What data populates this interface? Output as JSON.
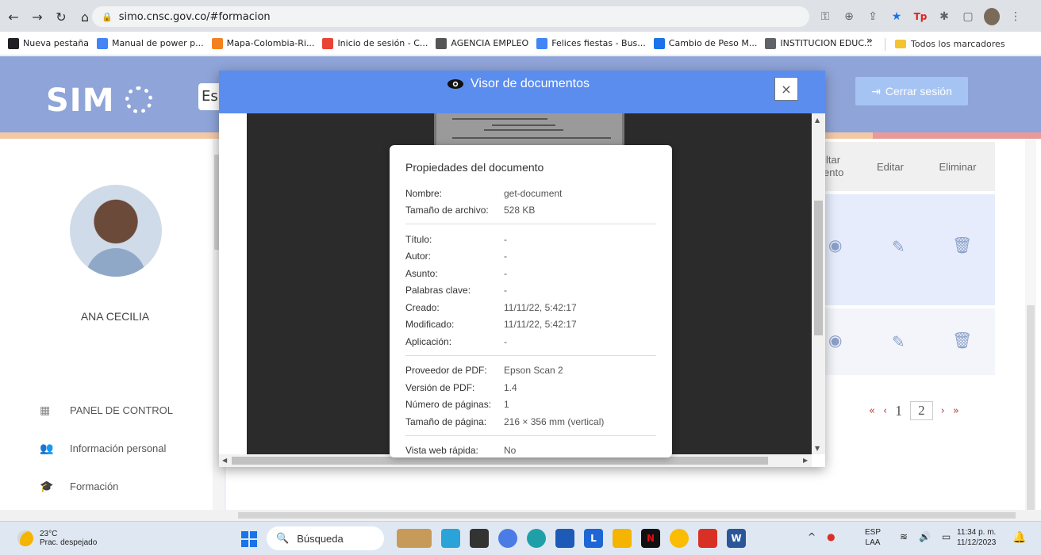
{
  "browser": {
    "url": "simo.cnsc.gov.co/#formacion",
    "bookmarks": [
      {
        "label": "Nueva pestaña",
        "icon": "globe-icon",
        "color": "#202124"
      },
      {
        "label": "Manual de power p...",
        "icon": "doc-icon",
        "color": "#4285f4"
      },
      {
        "label": "Mapa-Colombia-Ri...",
        "icon": "blogger-icon",
        "color": "#f4811f"
      },
      {
        "label": "Inicio de sesión - C...",
        "icon": "gmail-icon",
        "color": "#ea4335"
      },
      {
        "label": "AGENCIA EMPLEO",
        "icon": "agency-icon",
        "color": "#555555"
      },
      {
        "label": "Felices fiestas - Bus...",
        "icon": "google-icon",
        "color": "#4285f4"
      },
      {
        "label": "Cambio de Peso M...",
        "icon": "exchange-icon",
        "color": "#1a73e8"
      },
      {
        "label": "INSTITUCION EDUC...",
        "icon": "school-icon",
        "color": "#5f6368"
      }
    ],
    "bookmarks_more": "»",
    "all_bookmarks": "Todos los marcadores",
    "ext_tp": "Tp"
  },
  "site": {
    "logo_text": "SIM",
    "search_stub": "Es",
    "logout_label": "Cerrar sesión",
    "user_name": "ANA CECILIA",
    "sidebar": [
      {
        "label": "PANEL DE CONTROL",
        "icon": "dashboard-icon"
      },
      {
        "label": "Información personal",
        "icon": "people-icon"
      },
      {
        "label": "Formación",
        "icon": "education-icon"
      }
    ],
    "table": {
      "col_consult": "nsultar\numento",
      "col_edit": "Editar",
      "col_delete": "Eliminar"
    },
    "pager": {
      "first": "«",
      "prev": "‹",
      "page1": "1",
      "page2": "2",
      "next": "›",
      "last": "»"
    }
  },
  "modal": {
    "title": "Visor de documentos",
    "close": "×",
    "properties": {
      "heading": "Propiedades del documento",
      "group1": [
        {
          "k": "Nombre:",
          "v": "get-document"
        },
        {
          "k": "Tamaño de archivo:",
          "v": "528 KB"
        }
      ],
      "group2": [
        {
          "k": "Título:",
          "v": "-"
        },
        {
          "k": "Autor:",
          "v": "-"
        },
        {
          "k": "Asunto:",
          "v": "-"
        },
        {
          "k": "Palabras clave:",
          "v": "-"
        },
        {
          "k": "Creado:",
          "v": "11/11/22, 5:42:17"
        },
        {
          "k": "Modificado:",
          "v": "11/11/22, 5:42:17"
        },
        {
          "k": "Aplicación:",
          "v": "-"
        }
      ],
      "group3": [
        {
          "k": "Proveedor de PDF:",
          "v": "Epson Scan 2"
        },
        {
          "k": "Versión de PDF:",
          "v": "1.4"
        },
        {
          "k": "Número de páginas:",
          "v": "1"
        },
        {
          "k": "Tamaño de página:",
          "v": "216 × 356 mm (vertical)"
        }
      ],
      "group4": [
        {
          "k": "Vista web rápida:",
          "v": "No"
        }
      ]
    }
  },
  "taskbar": {
    "weather_temp": "23°C",
    "weather_desc": "Prac. despejado",
    "search_placeholder": "Búsqueda",
    "lang_line1": "ESP",
    "lang_line2": "LAA",
    "time": "11:34 p. m.",
    "date": "11/12/2023"
  }
}
